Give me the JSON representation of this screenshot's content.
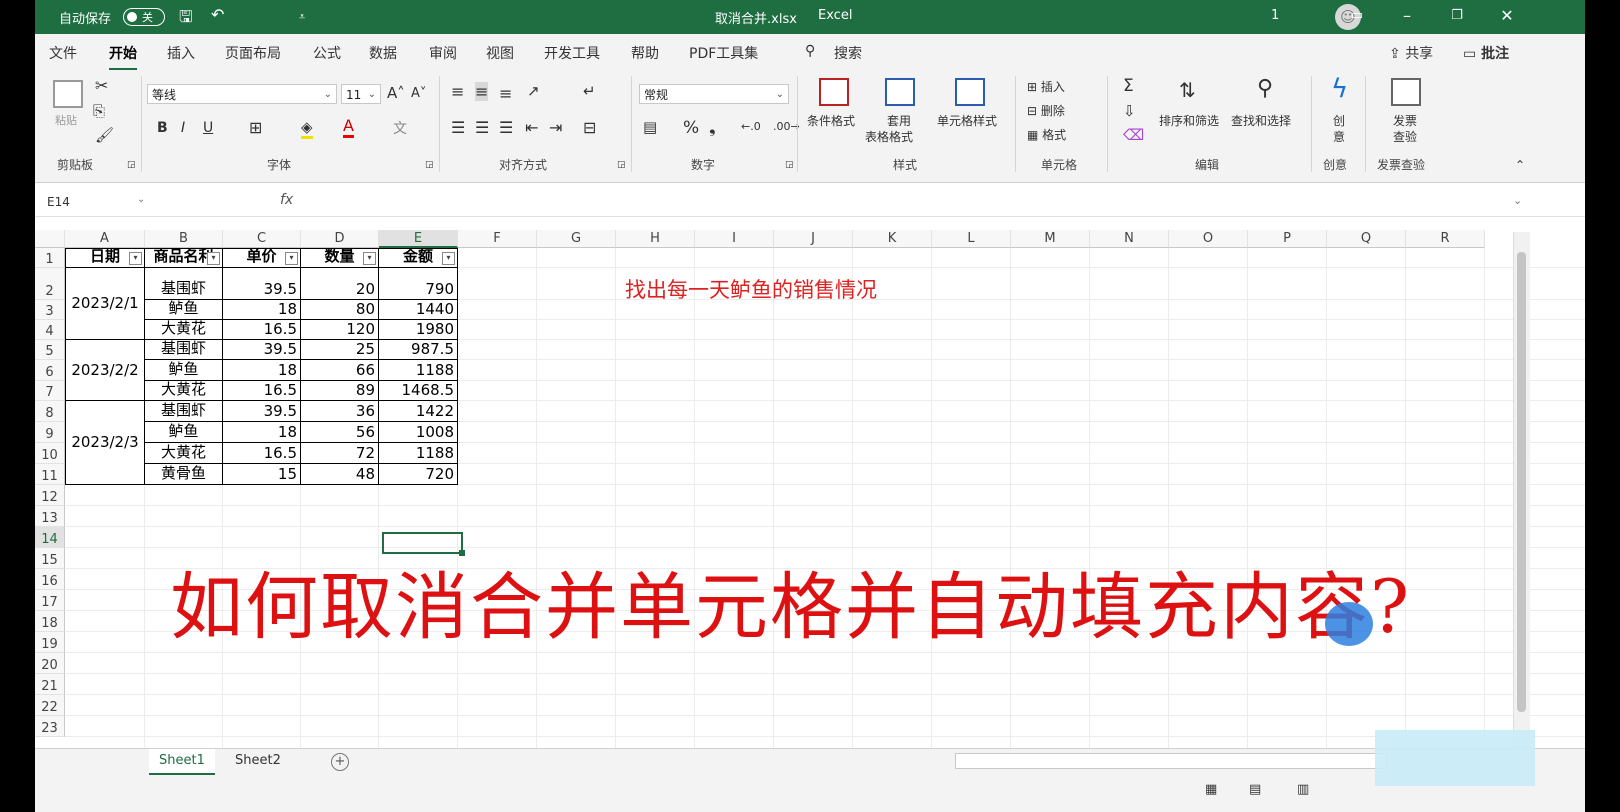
{
  "titlebar": {
    "autosave_label": "自动保存",
    "autosave_state": "关",
    "filename": "取消合并.xlsx",
    "app_name": "Excel",
    "user_count": "1"
  },
  "menu": {
    "tabs": [
      "文件",
      "开始",
      "插入",
      "页面布局",
      "公式",
      "数据",
      "审阅",
      "视图",
      "开发工具",
      "帮助",
      "PDF工具集"
    ],
    "active_tab": "开始",
    "search": "搜索",
    "share": "共享",
    "comments": "批注"
  },
  "ribbon": {
    "clipboard": {
      "group": "剪贴板",
      "paste": "粘贴"
    },
    "font": {
      "group": "字体",
      "name": "等线",
      "size": "11",
      "bold": "B",
      "italic": "I",
      "underline": "U"
    },
    "alignment": {
      "group": "对齐方式"
    },
    "number": {
      "group": "数字",
      "format": "常规",
      "percent": "%"
    },
    "styles": {
      "group": "样式",
      "conditional": "条件格式",
      "table_1": "套用",
      "table_2": "表格格式",
      "cell_styles": "单元格样式"
    },
    "cells": {
      "group": "单元格",
      "insert": "插入",
      "delete": "删除",
      "format": "格式"
    },
    "editing": {
      "group": "编辑",
      "sort_filter": "排序和筛选",
      "find_select": "查找和选择"
    },
    "creative": {
      "group": "创意",
      "label_1": "创",
      "label_2": "意"
    },
    "invoice": {
      "group": "发票查验",
      "label_1": "发票",
      "label_2": "查验"
    }
  },
  "formula_bar": {
    "name_box": "E14",
    "fx": "fx",
    "formula": ""
  },
  "sheet": {
    "columns": [
      "A",
      "B",
      "C",
      "D",
      "E",
      "F",
      "G",
      "H",
      "I",
      "J",
      "K",
      "L",
      "M",
      "N",
      "O",
      "P",
      "Q",
      "R"
    ],
    "rows": [
      "1",
      "2",
      "3",
      "4",
      "5",
      "6",
      "7",
      "8",
      "9",
      "10",
      "11",
      "12",
      "13",
      "14",
      "15",
      "16",
      "17",
      "18",
      "19",
      "20",
      "21",
      "22",
      "23"
    ],
    "selected_col": "E",
    "selected_row": "14",
    "headers": [
      "日期",
      "商品名称",
      "单价",
      "数量",
      "金额"
    ],
    "headers_shown": [
      "日期",
      "商品名利",
      "单价",
      "数量",
      "金额"
    ],
    "dates": [
      "2023/2/1",
      "2023/2/2",
      "2023/2/3"
    ],
    "records": [
      [
        "基围虾",
        "39.5",
        "20",
        "790"
      ],
      [
        "鲈鱼",
        "18",
        "80",
        "1440"
      ],
      [
        "大黄花",
        "16.5",
        "120",
        "1980"
      ],
      [
        "基围虾",
        "39.5",
        "25",
        "987.5"
      ],
      [
        "鲈鱼",
        "18",
        "66",
        "1188"
      ],
      [
        "大黄花",
        "16.5",
        "89",
        "1468.5"
      ],
      [
        "基围虾",
        "39.5",
        "36",
        "1422"
      ],
      [
        "鲈鱼",
        "18",
        "56",
        "1008"
      ],
      [
        "大黄花",
        "16.5",
        "72",
        "1188"
      ],
      [
        "黄骨鱼",
        "15",
        "48",
        "720"
      ]
    ],
    "note": "找出每一天鲈鱼的销售情况",
    "headline": "如何取消合并单元格并自动填充内容?"
  },
  "sheet_tabs": [
    "Sheet1",
    "Sheet2"
  ],
  "active_sheet": "Sheet1",
  "colors": {
    "excel_green": "#1e6e42",
    "annotation_red": "#dd2222"
  }
}
